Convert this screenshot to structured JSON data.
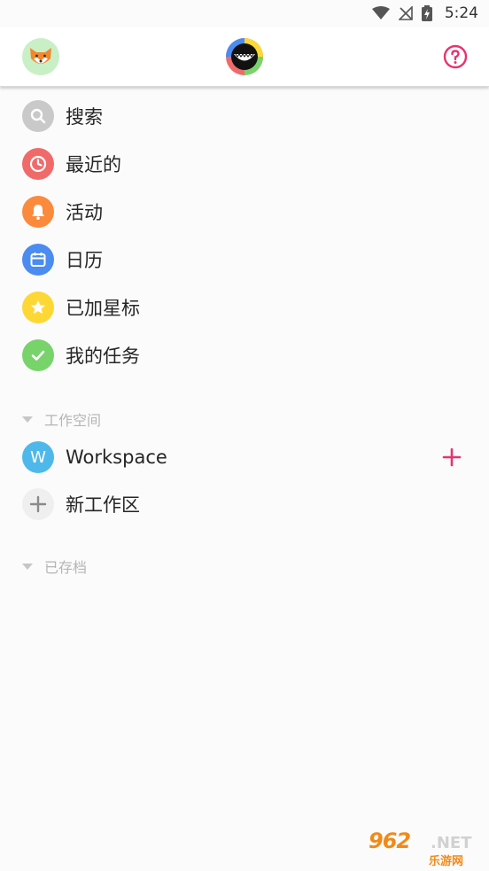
{
  "status_bar": {
    "time": "5:24"
  },
  "menu": {
    "items": [
      {
        "label": "搜索",
        "icon": "search-icon",
        "color": "#c4c4c4"
      },
      {
        "label": "最近的",
        "icon": "clock-icon",
        "color": "#f06a6a"
      },
      {
        "label": "活动",
        "icon": "bell-icon",
        "color": "#fb8a3c"
      },
      {
        "label": "日历",
        "icon": "calendar-icon",
        "color": "#4a8cf0"
      },
      {
        "label": "已加星标",
        "icon": "star-icon",
        "color": "#fdd835"
      },
      {
        "label": "我的任务",
        "icon": "check-icon",
        "color": "#78d36b"
      }
    ]
  },
  "workspaces": {
    "header": "工作空间",
    "items": [
      {
        "initial": "W",
        "name": "Workspace"
      }
    ],
    "new_label": "新工作区",
    "accent": "#e8336f"
  },
  "archived": {
    "header": "已存档"
  },
  "watermark": {
    "big": "962",
    "net": ".NET",
    "small": "乐游网"
  }
}
